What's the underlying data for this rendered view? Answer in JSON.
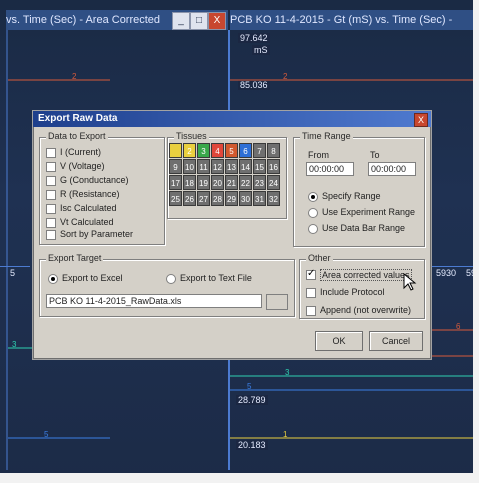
{
  "window_left": {
    "title": "vs. Time (Sec) - Area Corrected"
  },
  "window_right": {
    "title": "PCB KO 11-4-2015 - Gt (mS) vs. Time (Sec) -"
  },
  "window_buttons": {
    "minimize": "_",
    "maximize": "□",
    "close": "X"
  },
  "readouts": {
    "top_value": "97.642",
    "top_unit": "mS",
    "mid_value": "85.036",
    "lower_value": "28.789",
    "bottom_value": "20.183",
    "axis_left": "5",
    "axis_right_a": "5930",
    "axis_right_b": "59"
  },
  "dialog": {
    "title": "Export Raw Data",
    "close": "X",
    "data_to_export": {
      "label": "Data to Export",
      "items": [
        "I (Current)",
        "V (Voltage)",
        "G (Conductance)",
        "R (Resistance)",
        "Isc Calculated",
        "Vt Calculated"
      ],
      "sort_by_parameter": "Sort by Parameter"
    },
    "tissues": {
      "label": "Tissues",
      "cells": [
        "1",
        "2",
        "3",
        "4",
        "5",
        "6",
        "7",
        "8",
        "9",
        "10",
        "11",
        "12",
        "13",
        "14",
        "15",
        "16",
        "17",
        "18",
        "19",
        "20",
        "21",
        "22",
        "23",
        "24",
        "25",
        "26",
        "27",
        "28",
        "29",
        "30",
        "31",
        "32"
      ],
      "colors": [
        "#e9cf3f",
        "#e9cf3f",
        "#3aa84a",
        "#e0473a",
        "#d25a2e",
        "#2e6fd6",
        "#6f6f6f",
        "#6f6f6f"
      ]
    },
    "time_range": {
      "label": "Time Range",
      "from_label": "From",
      "to_label": "To",
      "from_value": "00:00:00",
      "to_value": "00:00:00",
      "options": [
        "Specify Range",
        "Use Experiment Range",
        "Use Data Bar Range"
      ],
      "selected": "Specify Range"
    },
    "export_target": {
      "label": "Export Target",
      "excel": "Export to Excel",
      "text_file": "Export to Text File",
      "selected": "Export to Excel",
      "file_name": "PCB KO 11-4-2015_RawData.xls"
    },
    "other": {
      "label": "Other",
      "area_corrected": "Area corrected values",
      "include_protocol": "Include Protocol",
      "append": "Append (not overwrite)",
      "area_corrected_checked": true
    },
    "ok_label": "OK",
    "cancel_label": "Cancel"
  },
  "trace_labels": {
    "two": "2",
    "three": "3",
    "five": "5",
    "six": "6",
    "one": "1"
  }
}
